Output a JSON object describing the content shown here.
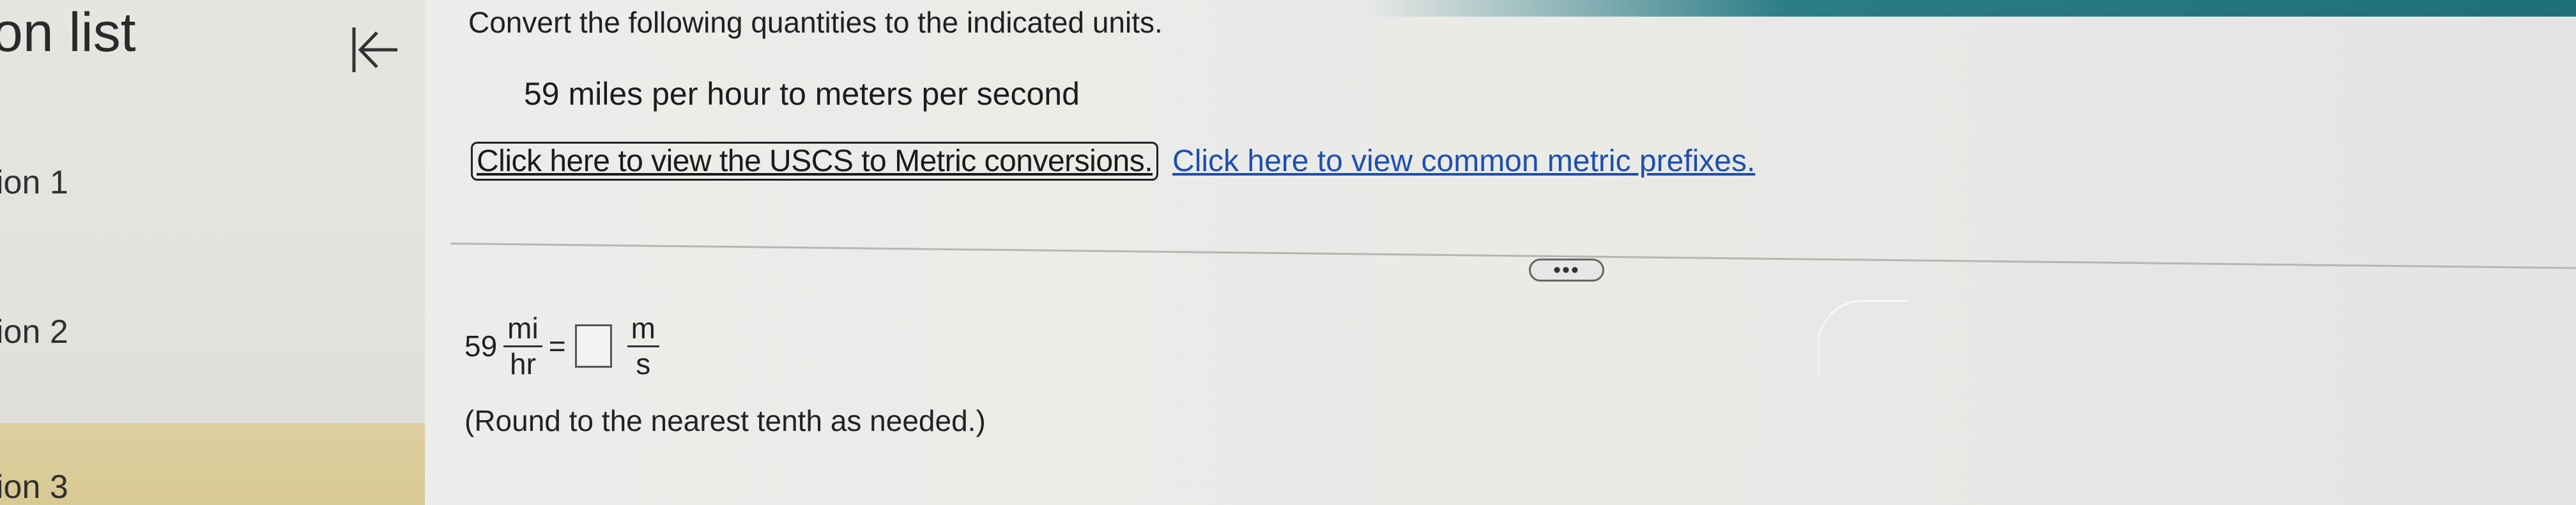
{
  "sidebar": {
    "title": "on list",
    "items": [
      {
        "label": "ion 1"
      },
      {
        "label": "ion 2"
      },
      {
        "label": "ion 3"
      }
    ]
  },
  "main": {
    "instructions": "Convert the following quantities to the indicated units.",
    "problem": "59 miles per hour to meters per second",
    "links": {
      "uscs": "Click here to view the USCS to Metric conversions.",
      "prefixes": "Click here to view common metric prefixes."
    },
    "more_label": "•••",
    "equation": {
      "value": "59",
      "from_num": "mi",
      "from_den": "hr",
      "equals": "=",
      "answer_value": "",
      "to_num": "m",
      "to_den": "s"
    },
    "note": "(Round to the nearest tenth as needed.)"
  },
  "colors": {
    "accent_bar": "#2b7c86",
    "link_blue": "#1d4fb0",
    "selected_item": "#dccfa0"
  },
  "icons": {
    "collapse": "collapse-left-icon"
  }
}
